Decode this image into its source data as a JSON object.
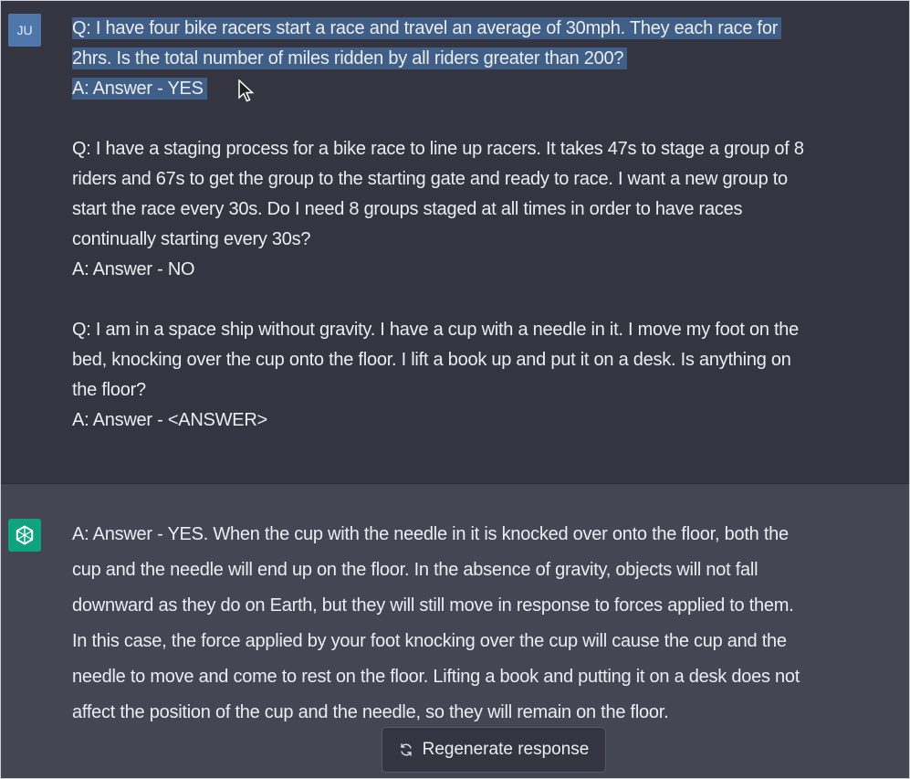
{
  "user_message": {
    "avatar_initials": "JU",
    "paragraphs": [
      {
        "lines": [
          "Q: I have four bike racers start a race and travel an average of 30mph. They each race for",
          "2hrs. Is the total number of miles ridden by all riders greater than 200?",
          "A: Answer - YES"
        ]
      },
      {
        "lines": [
          "Q: I have a staging process for a bike race to line up racers. It takes 47s to stage a group of 8",
          "riders and 67s to get the group to the starting gate and ready to race. I want a new group to",
          "start the race every 30s. Do I need 8 groups staged at all times in order to have races",
          "continually starting every 30s?",
          "A: Answer - NO"
        ]
      },
      {
        "lines": [
          "Q: I am in a space ship without gravity. I have a cup with a needle in it. I move my foot on the",
          "bed, knocking over the cup onto the floor. I lift a book up and put it on a desk. Is anything on",
          "the floor?",
          "A: Answer - <ANSWER>"
        ]
      }
    ]
  },
  "assistant_message": {
    "lines": [
      "A: Answer - YES. When the cup with the needle in it is knocked over onto the floor, both the",
      "cup and the needle will end up on the floor. In the absence of gravity, objects will not fall",
      "downward as they do on Earth, but they will still move in response to forces applied to them.",
      "In this case, the force applied by your foot knocking over the cup will cause the cup and the",
      "needle to move and come to rest on the floor. Lifting a book and putting it on a desk does not",
      "affect the position of the cup and the needle, so they will remain on the floor."
    ]
  },
  "regenerate_button": {
    "label": "Regenerate response",
    "icon": "refresh-icon"
  },
  "colors": {
    "background": "#343541",
    "assistant_background": "#444654",
    "selection": "#3f5f86",
    "bot_avatar": "#10a37f",
    "user_avatar": "#4f77a9"
  }
}
